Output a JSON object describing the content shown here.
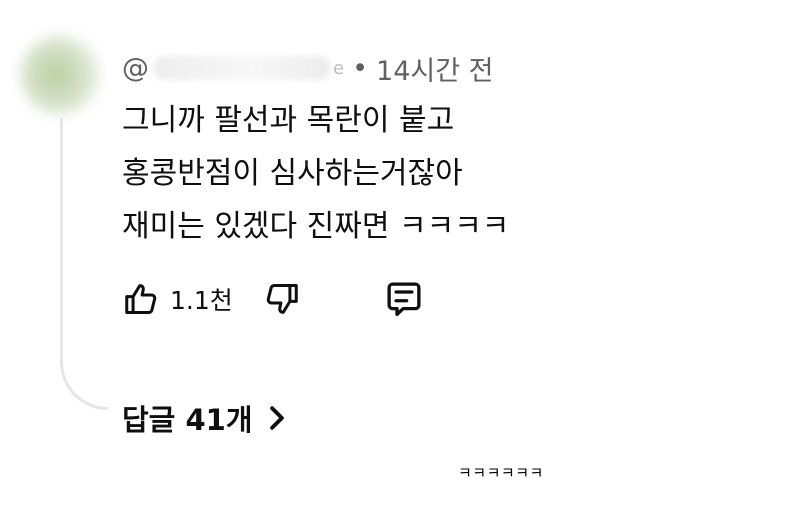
{
  "comment": {
    "handle_prefix": "@",
    "handle_suffix": "e",
    "separator": "•",
    "timestamp": "14시간 전",
    "lines": [
      "그니까 팔선과 목란이 붙고",
      "홍콩반점이 심사하는거잖아",
      "재미는 있겠다 진짜면 ㅋㅋㅋㅋ"
    ],
    "like_count": "1.1천",
    "replies_label": "답글 41개"
  },
  "footnote": "ㅋㅋㅋㅋㅋㅋ",
  "icons": {
    "like": "thumbs-up-icon",
    "dislike": "thumbs-down-icon",
    "reply": "comment-icon",
    "replies_chevron": "chevron-right-icon"
  },
  "colors": {
    "text": "#0f0f0f",
    "meta": "#606060",
    "thread_line": "#e6e6e6"
  }
}
